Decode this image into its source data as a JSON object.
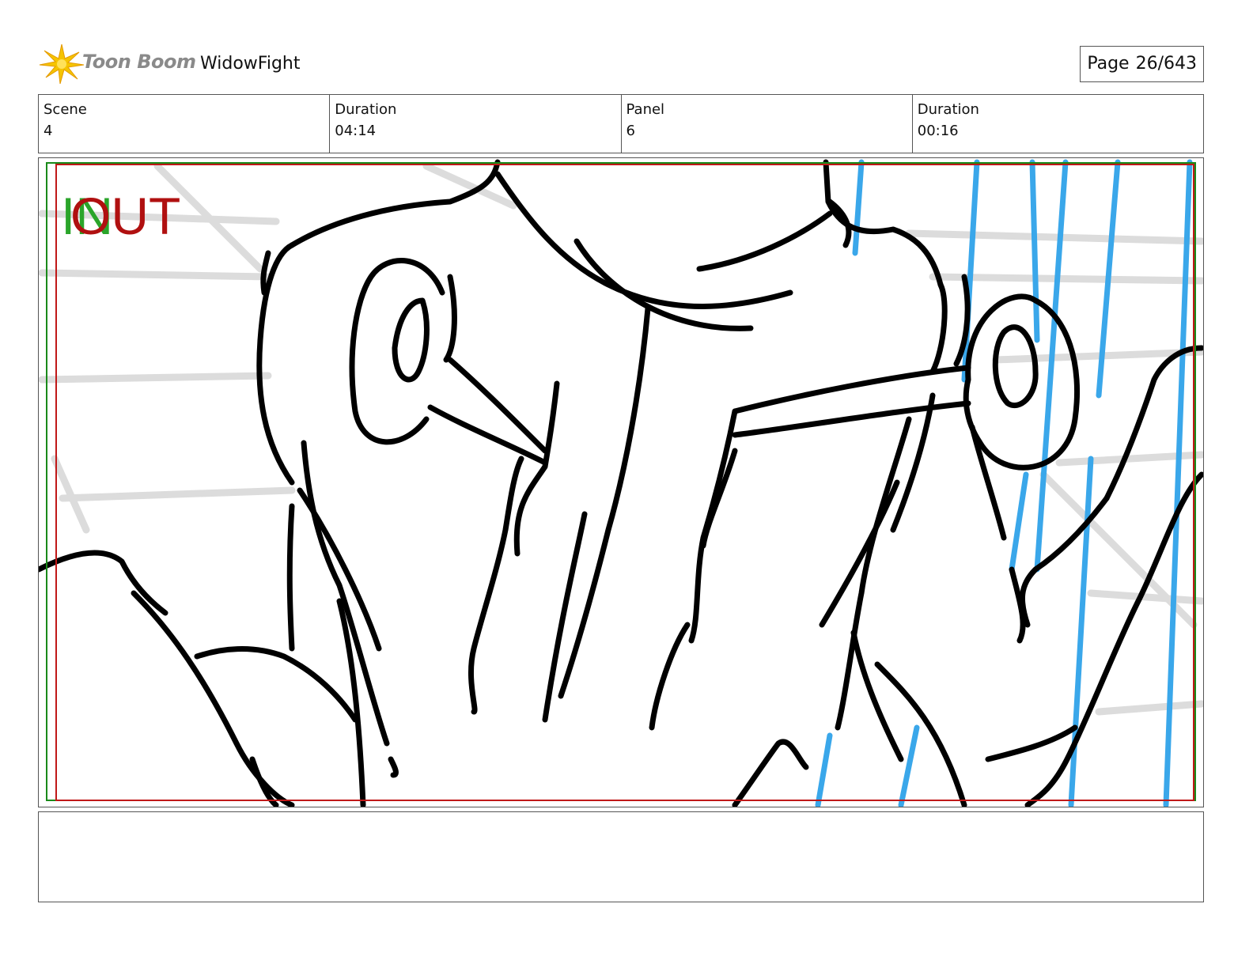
{
  "header": {
    "logo_text": "Toon Boom",
    "project_title": "WidowFight",
    "page_label": "Page",
    "page_value": "26/643"
  },
  "info": {
    "scene_label": "Scene",
    "scene_value": "4",
    "scene_duration_label": "Duration",
    "scene_duration_value": "04:14",
    "panel_label": "Panel",
    "panel_value": "6",
    "panel_duration_label": "Duration",
    "panel_duration_value": "00:16"
  },
  "panel_marks": {
    "in_text": "IN",
    "out_text": "OUT",
    "in_color": "#2aa52a",
    "out_color": "#b01010"
  },
  "notes": {
    "text": ""
  }
}
